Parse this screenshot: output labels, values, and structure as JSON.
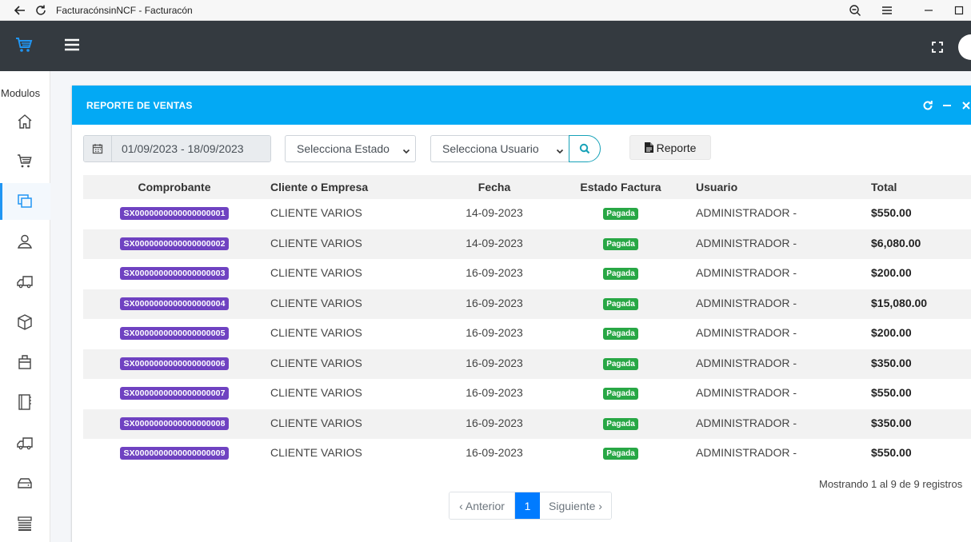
{
  "browser": {
    "title": "FacturacónsinNCF - Facturacón"
  },
  "sidebar": {
    "label": "Modulos",
    "items": [
      {
        "icon": "home-icon"
      },
      {
        "icon": "cart-icon"
      },
      {
        "icon": "copy-icon",
        "active": true
      },
      {
        "icon": "user-icon"
      },
      {
        "icon": "truck-icon"
      },
      {
        "icon": "box-icon"
      },
      {
        "icon": "briefcase-icon"
      },
      {
        "icon": "book-icon"
      },
      {
        "icon": "truck-icon"
      },
      {
        "icon": "drive-icon"
      },
      {
        "icon": "list-icon"
      }
    ]
  },
  "card": {
    "title": "REPORTE DE VENTAS"
  },
  "filters": {
    "date_range": "01/09/2023 - 18/09/2023",
    "estado_selected": "Selecciona Estado",
    "usuario_selected": "Selecciona Usuario",
    "report_label": "Reporte"
  },
  "table": {
    "headers": {
      "comprobante": "Comprobante",
      "cliente": "Cliente o Empresa",
      "fecha": "Fecha",
      "estado": "Estado Factura",
      "usuario": "Usuario",
      "total": "Total"
    },
    "rows": [
      {
        "comprobante": "SX0000000000000000001",
        "cliente": "CLIENTE VARIOS",
        "fecha": "14-09-2023",
        "estado": "Pagada",
        "usuario": "ADMINISTRADOR -",
        "total": "$550.00"
      },
      {
        "comprobante": "SX0000000000000000002",
        "cliente": "CLIENTE VARIOS",
        "fecha": "14-09-2023",
        "estado": "Pagada",
        "usuario": "ADMINISTRADOR -",
        "total": "$6,080.00"
      },
      {
        "comprobante": "SX0000000000000000003",
        "cliente": "CLIENTE VARIOS",
        "fecha": "16-09-2023",
        "estado": "Pagada",
        "usuario": "ADMINISTRADOR -",
        "total": "$200.00"
      },
      {
        "comprobante": "SX0000000000000000004",
        "cliente": "CLIENTE VARIOS",
        "fecha": "16-09-2023",
        "estado": "Pagada",
        "usuario": "ADMINISTRADOR -",
        "total": "$15,080.00"
      },
      {
        "comprobante": "SX0000000000000000005",
        "cliente": "CLIENTE VARIOS",
        "fecha": "16-09-2023",
        "estado": "Pagada",
        "usuario": "ADMINISTRADOR -",
        "total": "$200.00"
      },
      {
        "comprobante": "SX0000000000000000006",
        "cliente": "CLIENTE VARIOS",
        "fecha": "16-09-2023",
        "estado": "Pagada",
        "usuario": "ADMINISTRADOR -",
        "total": "$350.00"
      },
      {
        "comprobante": "SX0000000000000000007",
        "cliente": "CLIENTE VARIOS",
        "fecha": "16-09-2023",
        "estado": "Pagada",
        "usuario": "ADMINISTRADOR -",
        "total": "$550.00"
      },
      {
        "comprobante": "SX0000000000000000008",
        "cliente": "CLIENTE VARIOS",
        "fecha": "16-09-2023",
        "estado": "Pagada",
        "usuario": "ADMINISTRADOR -",
        "total": "$350.00"
      },
      {
        "comprobante": "SX0000000000000000009",
        "cliente": "CLIENTE VARIOS",
        "fecha": "16-09-2023",
        "estado": "Pagada",
        "usuario": "ADMINISTRADOR -",
        "total": "$550.00"
      }
    ]
  },
  "footer": {
    "summary": "Mostrando 1 al 9 de 9 registros",
    "prev_label": "‹ Anterior",
    "page": "1",
    "next_label": "Siguiente ›"
  },
  "colors": {
    "header_bg": "#343a40",
    "card_header": "#03a9f4",
    "accent": "#2196f3",
    "comp_badge": "#6f42c1",
    "status_badge": "#28a745",
    "page_active": "#007bff"
  }
}
